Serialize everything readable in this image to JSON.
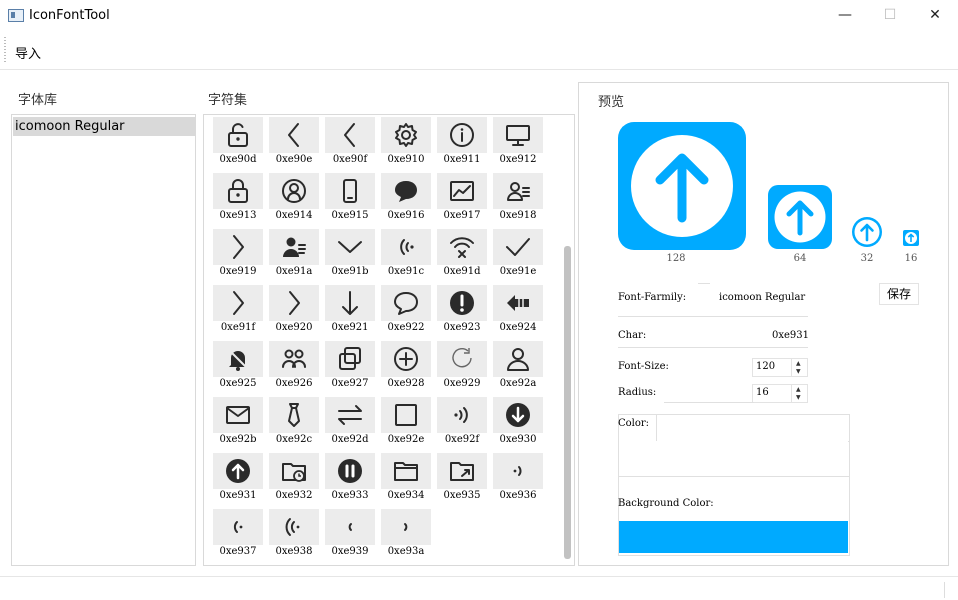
{
  "window": {
    "title": "IconFontTool",
    "minimize": "—",
    "maximize": "☐",
    "close": "✕"
  },
  "menu": {
    "import_label": "导入"
  },
  "fontlib": {
    "heading": "字体库",
    "items": [
      "icomoon Regular"
    ]
  },
  "charset": {
    "heading": "字符集",
    "glyphs": [
      {
        "code": "0xe90d",
        "icon": "unlock-icon"
      },
      {
        "code": "0xe90e",
        "icon": "chevron-left-bold-icon"
      },
      {
        "code": "0xe90f",
        "icon": "chevron-left-thin-icon"
      },
      {
        "code": "0xe910",
        "icon": "gear-icon"
      },
      {
        "code": "0xe911",
        "icon": "info-circle-icon"
      },
      {
        "code": "0xe912",
        "icon": "monitor-icon"
      },
      {
        "code": "0xe913",
        "icon": "lock-icon"
      },
      {
        "code": "0xe914",
        "icon": "user-circle-icon"
      },
      {
        "code": "0xe915",
        "icon": "phone-icon"
      },
      {
        "code": "0xe916",
        "icon": "chat-bubble-icon"
      },
      {
        "code": "0xe917",
        "icon": "chart-image-icon"
      },
      {
        "code": "0xe918",
        "icon": "user-card-icon"
      },
      {
        "code": "0xe919",
        "icon": "chevron-right-bold-icon"
      },
      {
        "code": "0xe91a",
        "icon": "user-list-icon"
      },
      {
        "code": "0xe91b",
        "icon": "chevron-down-icon"
      },
      {
        "code": "0xe91c",
        "icon": "signal-left-icon"
      },
      {
        "code": "0xe91d",
        "icon": "wifi-off-icon"
      },
      {
        "code": "0xe91e",
        "icon": "check-icon"
      },
      {
        "code": "0xe91f",
        "icon": "chevron-right-icon"
      },
      {
        "code": "0xe920",
        "icon": "chevron-right-thin-icon"
      },
      {
        "code": "0xe921",
        "icon": "arrow-down-icon"
      },
      {
        "code": "0xe922",
        "icon": "chat-outline-icon"
      },
      {
        "code": "0xe923",
        "icon": "alert-circle-icon"
      },
      {
        "code": "0xe924",
        "icon": "arrow-left-bold-icon"
      },
      {
        "code": "0xe925",
        "icon": "bell-off-icon"
      },
      {
        "code": "0xe926",
        "icon": "users-icon"
      },
      {
        "code": "0xe927",
        "icon": "copy-icon"
      },
      {
        "code": "0xe928",
        "icon": "plus-circle-icon"
      },
      {
        "code": "0xe929",
        "icon": "refresh-icon"
      },
      {
        "code": "0xe92a",
        "icon": "user-outline-icon"
      },
      {
        "code": "0xe92b",
        "icon": "mail-icon"
      },
      {
        "code": "0xe92c",
        "icon": "tie-icon"
      },
      {
        "code": "0xe92d",
        "icon": "swap-icon"
      },
      {
        "code": "0xe92e",
        "icon": "square-icon"
      },
      {
        "code": "0xe92f",
        "icon": "signal-right-icon"
      },
      {
        "code": "0xe930",
        "icon": "arrow-down-circle-icon"
      },
      {
        "code": "0xe931",
        "icon": "arrow-up-circle-icon"
      },
      {
        "code": "0xe932",
        "icon": "folder-clock-icon"
      },
      {
        "code": "0xe933",
        "icon": "pause-circle-icon"
      },
      {
        "code": "0xe934",
        "icon": "folder-icon"
      },
      {
        "code": "0xe935",
        "icon": "folder-share-icon"
      },
      {
        "code": "0xe936",
        "icon": "signal-small-right-icon"
      },
      {
        "code": "0xe937",
        "icon": "signal-small-left-icon"
      },
      {
        "code": "0xe938",
        "icon": "signal-double-left-icon"
      },
      {
        "code": "0xe939",
        "icon": "signal-tiny-left-icon"
      },
      {
        "code": "0xe93a",
        "icon": "signal-tiny-right-icon"
      }
    ]
  },
  "preview": {
    "heading": "预览",
    "color": "#00aaff",
    "sizes": [
      {
        "label": "128"
      },
      {
        "label": "64"
      },
      {
        "label": "32"
      },
      {
        "label": "16"
      }
    ],
    "font_family_label": "Font-Farmily:",
    "font_family_value": "icomoon Regular",
    "char_label": "Char:",
    "char_value": "0xe931",
    "font_size_label": "Font-Size:",
    "font_size_value": "120",
    "radius_label": "Radius:",
    "radius_value": "16",
    "color_label": "Color:",
    "bg_color_label": "Background Color:",
    "bg_color": "#00aaff",
    "save_label": "保存"
  }
}
